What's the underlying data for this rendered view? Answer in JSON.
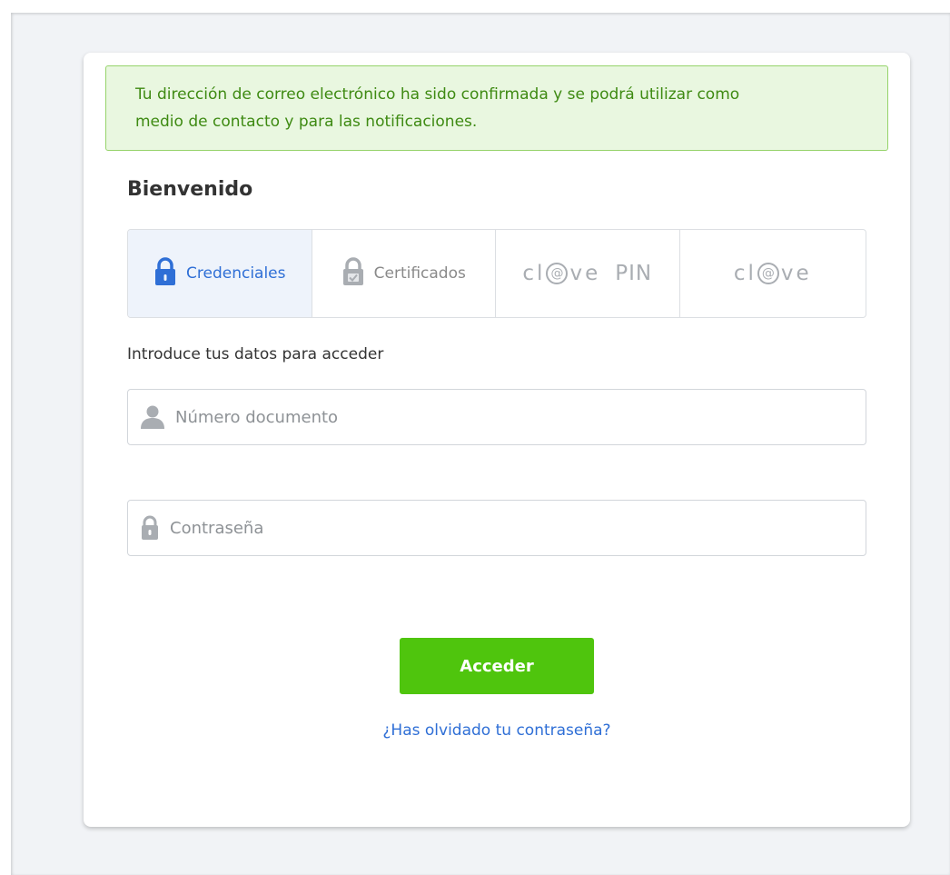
{
  "alert": {
    "line1": "Tu dirección de correo electrónico ha sido confirmada y se podrá utilizar como",
    "line2": "medio de contacto y para las notificaciones."
  },
  "title": "Bienvenido",
  "tabs": [
    {
      "label": "Credenciales",
      "icon": "lock-icon",
      "active": true
    },
    {
      "label": "Certificados",
      "icon": "certificate-lock-icon",
      "active": false
    },
    {
      "logo_text": "cl@ve",
      "logo_suffix": "PIN",
      "active": false
    },
    {
      "logo_text": "cl@ve",
      "active": false
    }
  ],
  "intro": "Introduce tus datos para acceder",
  "fields": {
    "document": {
      "placeholder": "Número documento",
      "value": "",
      "icon": "user-icon"
    },
    "password": {
      "placeholder": "Contraseña",
      "value": "",
      "icon": "lock-icon"
    }
  },
  "submit_label": "Acceder",
  "forgot_label": "¿Has olvidado tu contraseña?",
  "colors": {
    "accent_blue": "#2f6fd6",
    "button_green": "#4fc50d",
    "alert_bg": "#e9f7e0",
    "alert_text": "#3e8a12"
  }
}
